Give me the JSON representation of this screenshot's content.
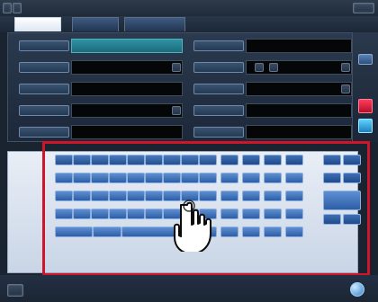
{
  "ui": {
    "tabs": [
      "",
      "",
      ""
    ],
    "fields_left": [
      {
        "label": "",
        "value": ""
      },
      {
        "label": "",
        "value": ""
      },
      {
        "label": "",
        "value": ""
      },
      {
        "label": "",
        "value": ""
      },
      {
        "label": "",
        "value": ""
      }
    ],
    "fields_right": [
      {
        "label": "",
        "value": ""
      },
      {
        "label": "",
        "value": ""
      },
      {
        "label": "",
        "value": ""
      },
      {
        "label": "",
        "value": ""
      },
      {
        "label": "",
        "value": ""
      }
    ],
    "keyboard": {
      "rows": [
        [
          "",
          "",
          "",
          "",
          "",
          "",
          "",
          "",
          "",
          "",
          "",
          "",
          "",
          "",
          ""
        ],
        [
          "",
          "",
          "",
          "",
          "",
          "",
          "",
          "",
          "",
          "",
          "",
          "",
          "",
          "",
          ""
        ],
        [
          "",
          "",
          "",
          "",
          "",
          "",
          "",
          "",
          "",
          "",
          "",
          "",
          "",
          "",
          ""
        ],
        [
          "",
          "",
          "",
          "",
          "",
          "",
          "",
          "",
          "",
          "",
          "",
          "",
          "",
          "",
          ""
        ],
        [
          "",
          "",
          "",
          "",
          "",
          "",
          "",
          "",
          "",
          "",
          "",
          "",
          "",
          "",
          ""
        ]
      ]
    },
    "colors": {
      "highlight": "#d0142a",
      "background": "#1a2431",
      "accent_teal": "#2e93a4",
      "key_blue": "#2c5ea8"
    },
    "icons": {
      "pointer": "tap-hand-icon",
      "cursor": "cursor-icon"
    }
  }
}
